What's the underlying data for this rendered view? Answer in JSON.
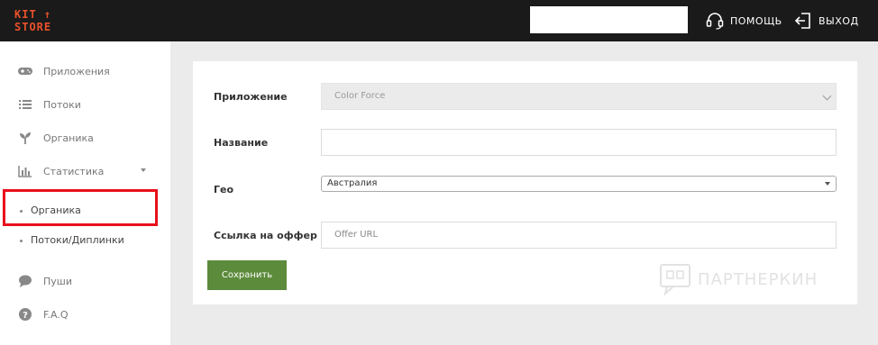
{
  "header": {
    "logo_line1": "KIT ↑",
    "logo_line2": "STORE",
    "search_value": "",
    "help_label": "ПОМОЩЬ",
    "logout_label": "ВЫХОД"
  },
  "sidebar": {
    "items": [
      {
        "label": "Приложения",
        "icon": "gamepad-icon"
      },
      {
        "label": "Потоки",
        "icon": "list-icon"
      },
      {
        "label": "Органика",
        "icon": "sprout-icon"
      },
      {
        "label": "Статистика",
        "icon": "bar-chart-icon"
      }
    ],
    "sub_items": [
      {
        "label": "Органика"
      },
      {
        "label": "Потоки/Диплинки"
      }
    ],
    "bottom_items": [
      {
        "label": "Пуши",
        "icon": "chat-bubble-icon"
      },
      {
        "label": "F.A.Q",
        "icon": "question-circle-icon"
      }
    ]
  },
  "form": {
    "app_label": "Приложение",
    "app_value": "Color Force",
    "name_label": "Название",
    "name_value": "",
    "geo_label": "Гео",
    "geo_value": "Австралия",
    "offer_label": "Ссылка на оффер",
    "offer_placeholder": "Offer URL",
    "save_label": "Сохранить"
  },
  "watermark": {
    "text": "ПАРТНЕРКИН"
  },
  "colors": {
    "topbar": "#1a1a1a",
    "logo": "#e8512b",
    "save_button": "#5d8b3c",
    "highlight": "#e8101b"
  }
}
